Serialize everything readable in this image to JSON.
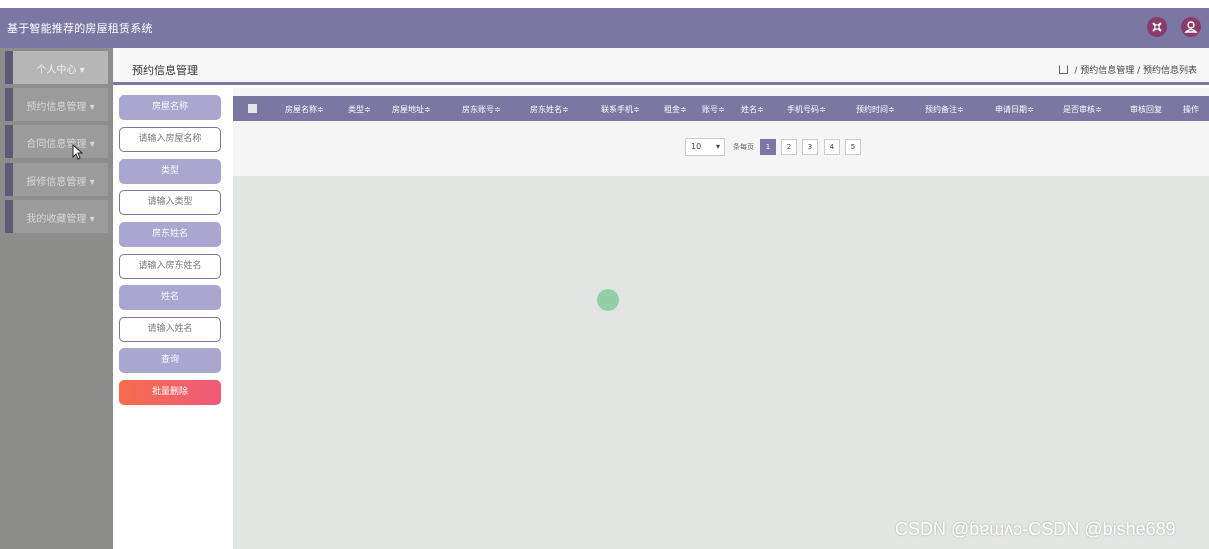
{
  "header": {
    "app_title": "基于智能推荐的房屋租赁系统",
    "icons": [
      "settings-icon",
      "user-icon"
    ]
  },
  "sidebar": {
    "items": [
      {
        "label": "个人中心 ▾"
      },
      {
        "label": "预约信息管理 ▾"
      },
      {
        "label": "合同信息管理 ▾"
      },
      {
        "label": "报修信息管理 ▾"
      },
      {
        "label": "我的收藏管理 ▾"
      }
    ]
  },
  "page": {
    "title": "预约信息管理",
    "breadcrumb": " / 预约信息管理 / 预约信息列表"
  },
  "filters": {
    "house_name_label": "房屋名称",
    "house_name_placeholder": "请输入房屋名称",
    "type_label": "类型",
    "type_placeholder": "请输入类型",
    "landlord_label": "房东姓名",
    "landlord_placeholder": "请输入房东姓名",
    "name_label": "姓名",
    "name_placeholder": "请输入姓名",
    "query_button": "查询",
    "batch_delete_button": "批量删除"
  },
  "table": {
    "columns": [
      "房屋名称≑",
      "类型≑",
      "房屋地址≑",
      "房东账号≑",
      "房东姓名≑",
      "联系手机≑",
      "租金≑",
      "账号≑",
      "姓名≑",
      "手机号码≑",
      "预约时间≑",
      "预约备注≑",
      "申请日期≑",
      "是否审核≑",
      "审核回复",
      "操作"
    ]
  },
  "pagination": {
    "page_size": "10",
    "per_page_label": "条每页",
    "pages": [
      "1",
      "2",
      "3",
      "4",
      "5"
    ],
    "current_page": "1"
  },
  "watermark": "CSDN @ɓɐɯʌɔ-CSDN @bishe689",
  "colors": {
    "brand": "#7a77a2",
    "sidebar": "#8d8d8b",
    "delete": "#f2606a"
  }
}
